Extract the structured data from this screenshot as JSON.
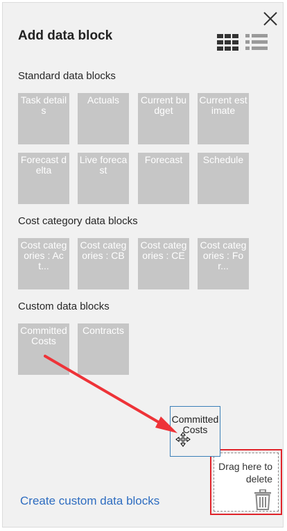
{
  "panel": {
    "title": "Add data block",
    "close_icon": "close-icon",
    "view_grid_icon": "grid-view-icon",
    "view_list_icon": "list-view-icon"
  },
  "sections": {
    "standard": {
      "label": "Standard data blocks",
      "tiles": [
        {
          "label": "Task details"
        },
        {
          "label": "Actuals"
        },
        {
          "label": "Current budget"
        },
        {
          "label": "Current estimate"
        },
        {
          "label": "Forecast delta"
        },
        {
          "label": "Live forecast"
        },
        {
          "label": "Forecast"
        },
        {
          "label": "Schedule"
        }
      ]
    },
    "cost_category": {
      "label": "Cost category data blocks",
      "tiles": [
        {
          "label": "Cost categories : Act..."
        },
        {
          "label": "Cost categories : CB"
        },
        {
          "label": "Cost categories : CE"
        },
        {
          "label": "Cost categories : For..."
        }
      ]
    },
    "custom": {
      "label": "Custom data blocks",
      "tiles": [
        {
          "label": "Committed Costs"
        },
        {
          "label": "Contracts"
        }
      ]
    }
  },
  "drag": {
    "ghost_label": "Committed Costs",
    "cursor_icon": "move-cursor-icon",
    "arrow_color": "#ee3338"
  },
  "delete_zone": {
    "text": "Drag here to delete",
    "icon": "trash-icon",
    "highlight_color": "#e0242b"
  },
  "footer": {
    "create_link": "Create custom data blocks"
  },
  "colors": {
    "panel_bg": "#f1f1f1",
    "tile_bg": "#c6c6c6",
    "tile_text": "#ffffff",
    "link": "#2d6cc0"
  }
}
